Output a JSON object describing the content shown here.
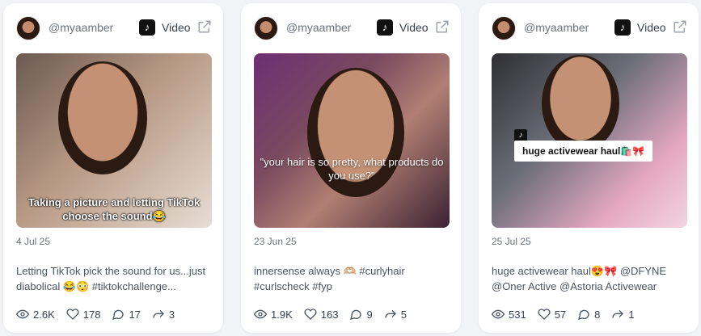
{
  "cards": [
    {
      "handle": "@myaamber",
      "type_label": "Video",
      "thumbnail_caption": "Taking a picture and letting TikTok choose the sound😂",
      "date": "4 Jul 25",
      "description": "Letting TikTok pick the sound for us...just diabolical 😂😳 #tiktokchallenge...",
      "stats": {
        "views": "2.6K",
        "likes": "178",
        "comments": "17",
        "shares": "3"
      }
    },
    {
      "handle": "@myaamber",
      "type_label": "Video",
      "thumbnail_caption": "\"your hair is so pretty, what products do you use?\"",
      "date": "23 Jun 25",
      "description": "innersense always 🫶🏼 #curlyhair #curlscheck #fyp",
      "stats": {
        "views": "1.9K",
        "likes": "163",
        "comments": "9",
        "shares": "5"
      }
    },
    {
      "handle": "@myaamber",
      "type_label": "Video",
      "thumbnail_caption": "huge activewear haul🛍️🎀",
      "date": "25 Jul 25",
      "description": "huge activewear haul😍🎀 @DFYNE @Oner Active @Astoria Activewear #ha...",
      "stats": {
        "views": "531",
        "likes": "57",
        "comments": "8",
        "shares": "1"
      }
    }
  ],
  "icons": {
    "platform": "tiktok-icon",
    "open": "external-link-icon",
    "views": "eye-icon",
    "likes": "heart-icon",
    "comments": "comment-icon",
    "shares": "share-icon"
  },
  "colors": {
    "background": "#f2f3f5",
    "card": "#ffffff",
    "text_muted": "#6b7280"
  }
}
